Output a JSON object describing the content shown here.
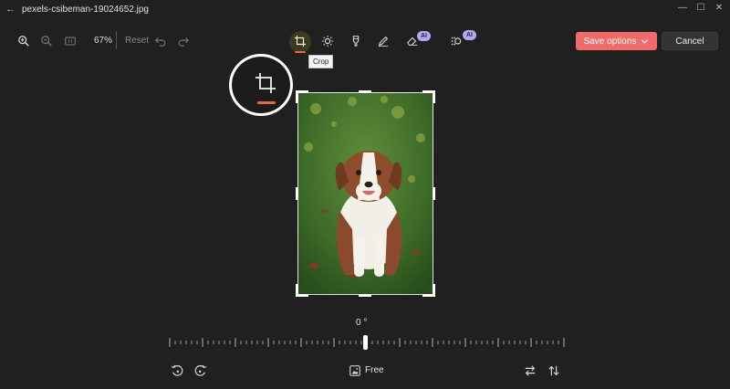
{
  "window": {
    "title": "pexels-csibeman-19024652.jpg",
    "back_glyph": "←",
    "minimize_glyph": "—",
    "maximize_glyph": "☐",
    "close_glyph": "✕"
  },
  "toolbar": {
    "zoom_value": "67%",
    "reset_label": "Reset",
    "icons": [
      "zoom-in-icon",
      "zoom-out-icon",
      "actual-size-icon",
      "undo-icon",
      "redo-icon",
      "crop-icon",
      "adjust-brightness-icon",
      "filter-icon",
      "markup-icon",
      "erase-icon",
      "background-blur-icon"
    ],
    "ai_badge_label": "AI",
    "save_label": "Save options",
    "cancel_label": "Cancel",
    "accent_color": "#f06a6a"
  },
  "tooltip": {
    "text": "Crop"
  },
  "crop": {
    "rotation_value": "0 °",
    "aspect_label": "Free",
    "selection_accent": "#e8684a"
  },
  "bottom_icons": [
    "rotate-left-icon",
    "rotate-right-icon",
    "aspect-ratio-icon",
    "flip-horizontal-icon",
    "flip-vertical-icon"
  ]
}
